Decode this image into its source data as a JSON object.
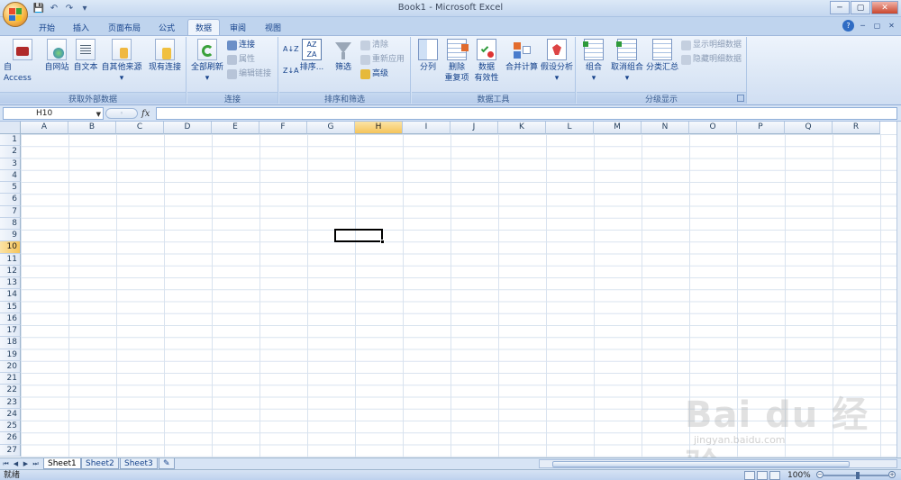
{
  "window": {
    "title": "Book1 - Microsoft Excel",
    "min": "─",
    "max": "▢",
    "close": "✕"
  },
  "qat": {
    "save": "💾",
    "undo": "↶",
    "redo": "↷",
    "more": "▾"
  },
  "tabs": [
    "开始",
    "插入",
    "页面布局",
    "公式",
    "数据",
    "审阅",
    "视图"
  ],
  "active_tab": "数据",
  "help": "?",
  "ribbon": {
    "groups": {
      "get_external": "获取外部数据",
      "connections": "连接",
      "sort_filter": "排序和筛选",
      "data_tools": "数据工具",
      "outline": "分级显示"
    },
    "get_external": {
      "access": "自 Access",
      "web": "自网站",
      "text": "自文本",
      "other": "自其他来源",
      "existing": "现有连接"
    },
    "connections": {
      "refresh_all": "全部刷新",
      "connections": "连接",
      "properties": "属性",
      "edit_links": "编辑链接"
    },
    "sort_filter": {
      "sort_az": "A↓Z",
      "sort_za": "Z↓A",
      "sort": "排序...",
      "filter": "筛选",
      "clear": "清除",
      "reapply": "重新应用",
      "advanced": "高级"
    },
    "data_tools": {
      "text_to_cols": "分列",
      "remove_dup_1": "删除",
      "remove_dup_2": "重复项",
      "validation_1": "数据",
      "validation_2": "有效性",
      "consolidate": "合并计算",
      "what_if": "假设分析"
    },
    "outline": {
      "group": "组合",
      "ungroup": "取消组合",
      "subtotal": "分类汇总",
      "show_detail": "显示明细数据",
      "hide_detail": "隐藏明细数据"
    }
  },
  "formula_bar": {
    "name_box": "H10",
    "fx": "fx",
    "circle": "◦",
    "value": ""
  },
  "columns": [
    "A",
    "B",
    "C",
    "D",
    "E",
    "F",
    "G",
    "H",
    "I",
    "J",
    "K",
    "L",
    "M",
    "N",
    "O",
    "P",
    "Q",
    "R"
  ],
  "selected_column": "H",
  "rows": [
    "1",
    "2",
    "3",
    "4",
    "5",
    "6",
    "7",
    "8",
    "9",
    "10",
    "11",
    "12",
    "13",
    "14",
    "15",
    "16",
    "17",
    "18",
    "19",
    "20",
    "21",
    "22",
    "23",
    "24",
    "25",
    "26",
    "27"
  ],
  "selected_row": "10",
  "sheets": [
    "Sheet1",
    "Sheet2",
    "Sheet3"
  ],
  "active_sheet": "Sheet1",
  "status": {
    "ready": "就绪",
    "zoom": "100%"
  },
  "watermark": {
    "brand": "Bai du 经验",
    "url": "jingyan.baidu.com"
  }
}
